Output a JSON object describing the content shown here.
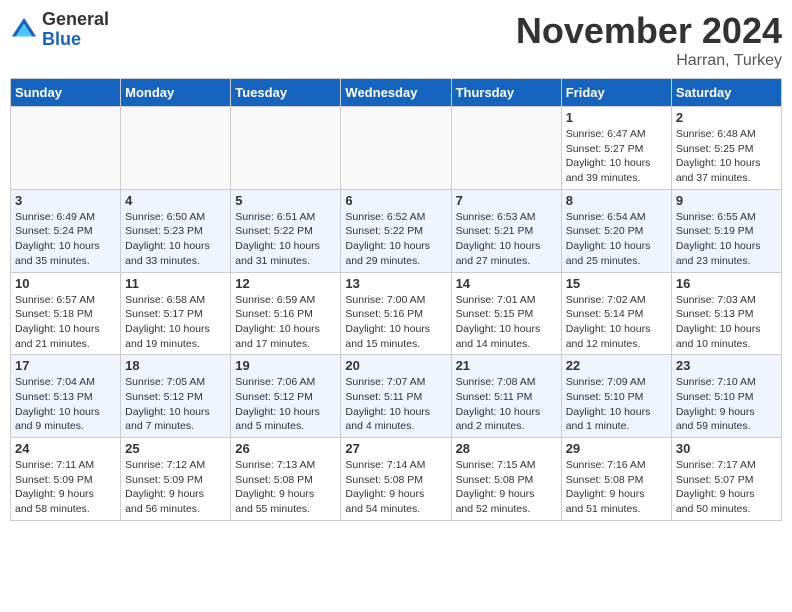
{
  "header": {
    "logo_general": "General",
    "logo_blue": "Blue",
    "month_title": "November 2024",
    "location": "Harran, Turkey"
  },
  "days_of_week": [
    "Sunday",
    "Monday",
    "Tuesday",
    "Wednesday",
    "Thursday",
    "Friday",
    "Saturday"
  ],
  "weeks": [
    [
      {
        "day": "",
        "detail": ""
      },
      {
        "day": "",
        "detail": ""
      },
      {
        "day": "",
        "detail": ""
      },
      {
        "day": "",
        "detail": ""
      },
      {
        "day": "",
        "detail": ""
      },
      {
        "day": "1",
        "detail": "Sunrise: 6:47 AM\nSunset: 5:27 PM\nDaylight: 10 hours\nand 39 minutes."
      },
      {
        "day": "2",
        "detail": "Sunrise: 6:48 AM\nSunset: 5:25 PM\nDaylight: 10 hours\nand 37 minutes."
      }
    ],
    [
      {
        "day": "3",
        "detail": "Sunrise: 6:49 AM\nSunset: 5:24 PM\nDaylight: 10 hours\nand 35 minutes."
      },
      {
        "day": "4",
        "detail": "Sunrise: 6:50 AM\nSunset: 5:23 PM\nDaylight: 10 hours\nand 33 minutes."
      },
      {
        "day": "5",
        "detail": "Sunrise: 6:51 AM\nSunset: 5:22 PM\nDaylight: 10 hours\nand 31 minutes."
      },
      {
        "day": "6",
        "detail": "Sunrise: 6:52 AM\nSunset: 5:22 PM\nDaylight: 10 hours\nand 29 minutes."
      },
      {
        "day": "7",
        "detail": "Sunrise: 6:53 AM\nSunset: 5:21 PM\nDaylight: 10 hours\nand 27 minutes."
      },
      {
        "day": "8",
        "detail": "Sunrise: 6:54 AM\nSunset: 5:20 PM\nDaylight: 10 hours\nand 25 minutes."
      },
      {
        "day": "9",
        "detail": "Sunrise: 6:55 AM\nSunset: 5:19 PM\nDaylight: 10 hours\nand 23 minutes."
      }
    ],
    [
      {
        "day": "10",
        "detail": "Sunrise: 6:57 AM\nSunset: 5:18 PM\nDaylight: 10 hours\nand 21 minutes."
      },
      {
        "day": "11",
        "detail": "Sunrise: 6:58 AM\nSunset: 5:17 PM\nDaylight: 10 hours\nand 19 minutes."
      },
      {
        "day": "12",
        "detail": "Sunrise: 6:59 AM\nSunset: 5:16 PM\nDaylight: 10 hours\nand 17 minutes."
      },
      {
        "day": "13",
        "detail": "Sunrise: 7:00 AM\nSunset: 5:16 PM\nDaylight: 10 hours\nand 15 minutes."
      },
      {
        "day": "14",
        "detail": "Sunrise: 7:01 AM\nSunset: 5:15 PM\nDaylight: 10 hours\nand 14 minutes."
      },
      {
        "day": "15",
        "detail": "Sunrise: 7:02 AM\nSunset: 5:14 PM\nDaylight: 10 hours\nand 12 minutes."
      },
      {
        "day": "16",
        "detail": "Sunrise: 7:03 AM\nSunset: 5:13 PM\nDaylight: 10 hours\nand 10 minutes."
      }
    ],
    [
      {
        "day": "17",
        "detail": "Sunrise: 7:04 AM\nSunset: 5:13 PM\nDaylight: 10 hours\nand 9 minutes."
      },
      {
        "day": "18",
        "detail": "Sunrise: 7:05 AM\nSunset: 5:12 PM\nDaylight: 10 hours\nand 7 minutes."
      },
      {
        "day": "19",
        "detail": "Sunrise: 7:06 AM\nSunset: 5:12 PM\nDaylight: 10 hours\nand 5 minutes."
      },
      {
        "day": "20",
        "detail": "Sunrise: 7:07 AM\nSunset: 5:11 PM\nDaylight: 10 hours\nand 4 minutes."
      },
      {
        "day": "21",
        "detail": "Sunrise: 7:08 AM\nSunset: 5:11 PM\nDaylight: 10 hours\nand 2 minutes."
      },
      {
        "day": "22",
        "detail": "Sunrise: 7:09 AM\nSunset: 5:10 PM\nDaylight: 10 hours\nand 1 minute."
      },
      {
        "day": "23",
        "detail": "Sunrise: 7:10 AM\nSunset: 5:10 PM\nDaylight: 9 hours\nand 59 minutes."
      }
    ],
    [
      {
        "day": "24",
        "detail": "Sunrise: 7:11 AM\nSunset: 5:09 PM\nDaylight: 9 hours\nand 58 minutes."
      },
      {
        "day": "25",
        "detail": "Sunrise: 7:12 AM\nSunset: 5:09 PM\nDaylight: 9 hours\nand 56 minutes."
      },
      {
        "day": "26",
        "detail": "Sunrise: 7:13 AM\nSunset: 5:08 PM\nDaylight: 9 hours\nand 55 minutes."
      },
      {
        "day": "27",
        "detail": "Sunrise: 7:14 AM\nSunset: 5:08 PM\nDaylight: 9 hours\nand 54 minutes."
      },
      {
        "day": "28",
        "detail": "Sunrise: 7:15 AM\nSunset: 5:08 PM\nDaylight: 9 hours\nand 52 minutes."
      },
      {
        "day": "29",
        "detail": "Sunrise: 7:16 AM\nSunset: 5:08 PM\nDaylight: 9 hours\nand 51 minutes."
      },
      {
        "day": "30",
        "detail": "Sunrise: 7:17 AM\nSunset: 5:07 PM\nDaylight: 9 hours\nand 50 minutes."
      }
    ]
  ]
}
